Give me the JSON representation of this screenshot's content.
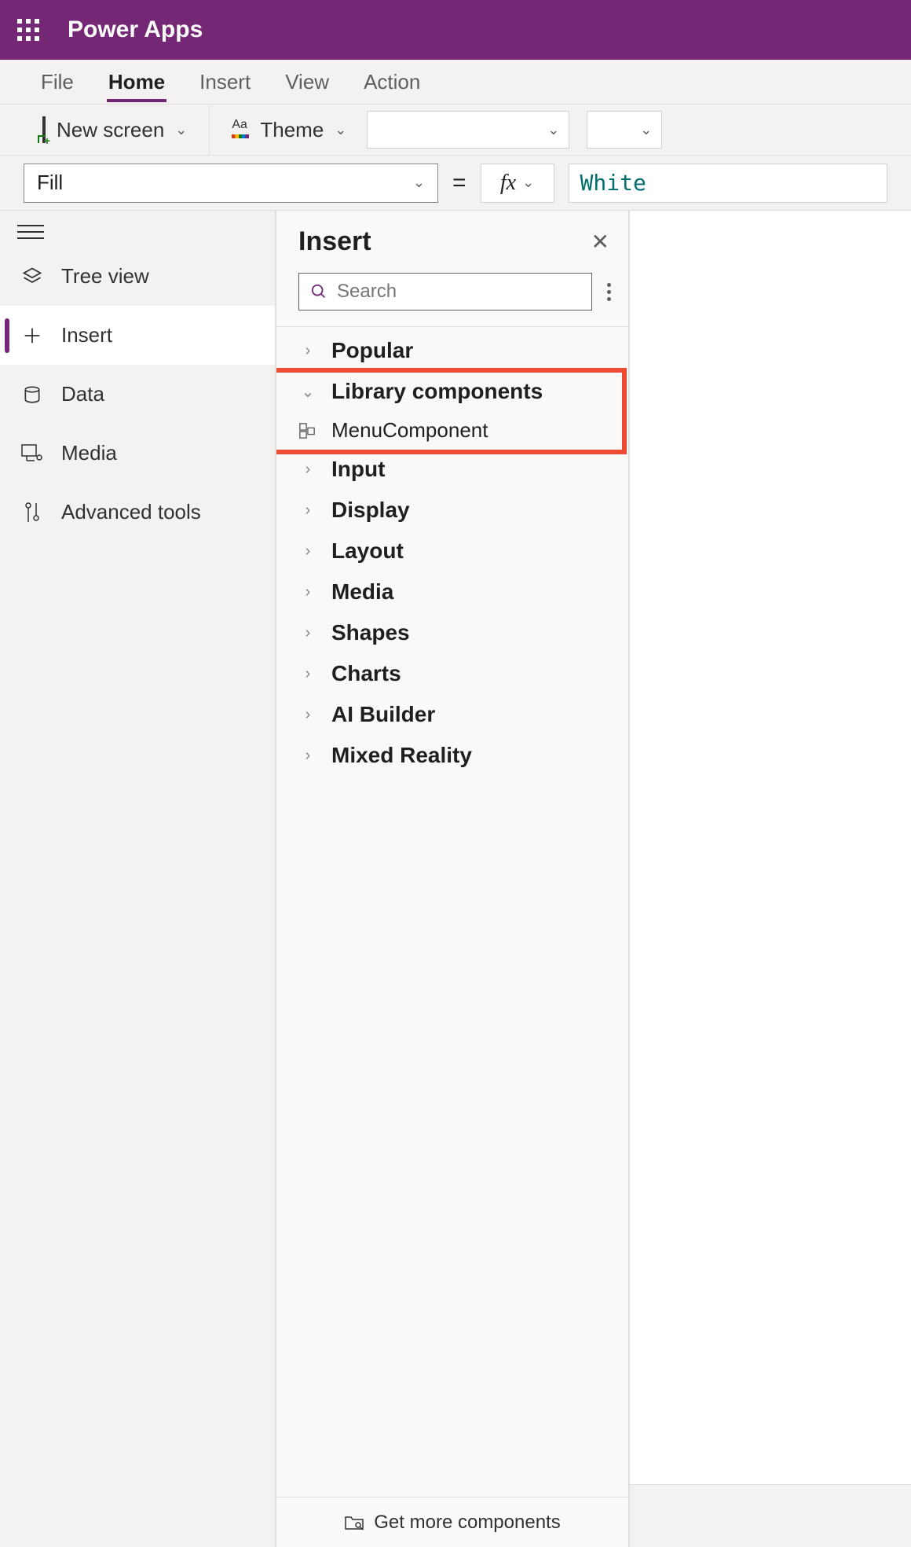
{
  "header": {
    "app_name": "Power Apps"
  },
  "tabs": {
    "items": [
      {
        "label": "File"
      },
      {
        "label": "Home"
      },
      {
        "label": "Insert"
      },
      {
        "label": "View"
      },
      {
        "label": "Action"
      }
    ],
    "active_index": 1
  },
  "ribbon": {
    "new_screen": "New screen",
    "theme": "Theme"
  },
  "formula_bar": {
    "property": "Fill",
    "equals": "=",
    "fx": "fx",
    "value": "White"
  },
  "left_nav": {
    "items": [
      {
        "label": "Tree view"
      },
      {
        "label": "Insert"
      },
      {
        "label": "Data"
      },
      {
        "label": "Media"
      },
      {
        "label": "Advanced tools"
      }
    ],
    "active_index": 1
  },
  "insert_panel": {
    "title": "Insert",
    "search_placeholder": "Search",
    "categories": [
      {
        "label": "Popular",
        "expanded": false
      },
      {
        "label": "Library components",
        "expanded": true,
        "children": [
          {
            "label": "MenuComponent"
          }
        ]
      },
      {
        "label": "Input",
        "expanded": false
      },
      {
        "label": "Display",
        "expanded": false
      },
      {
        "label": "Layout",
        "expanded": false
      },
      {
        "label": "Media",
        "expanded": false
      },
      {
        "label": "Shapes",
        "expanded": false
      },
      {
        "label": "Charts",
        "expanded": false
      },
      {
        "label": "AI Builder",
        "expanded": false
      },
      {
        "label": "Mixed Reality",
        "expanded": false
      }
    ],
    "footer": "Get more components"
  }
}
